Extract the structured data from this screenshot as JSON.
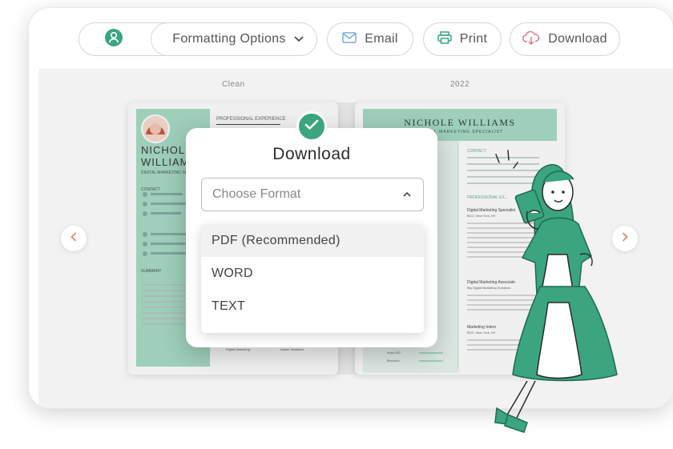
{
  "toolbar": {
    "profile_button": {
      "icon": "user-icon",
      "caret": "chevron-down-icon"
    },
    "formatting_label": "Formatting Options",
    "email_label": "Email",
    "print_label": "Print",
    "download_label": "Download"
  },
  "templates": {
    "left_label": "Clean",
    "right_label": "2022"
  },
  "resume_left": {
    "section_experience": "PROFESSIONAL EXPERIENCE",
    "name_line1": "NICHOLE",
    "name_line2": "WILLIAMS",
    "subtitle": "DIGITAL MARKETING SP",
    "contact_heading": "CONTACT",
    "summary_heading": "SUMMARY",
    "summary_text": "Digital Marketing Special... years of experience in... marketing, branding, an... strategy across multi... reinforcement industries... expanding Vicarious cent... implementing multi-pron... strategies that increase... drive brand growth.",
    "skill_a": "Digital Marketing",
    "skill_b": "Adobe Illustrator"
  },
  "resume_right": {
    "name": "NICHOLE WILLIAMS",
    "subtitle": "DIGITAL MARKETING SPECIALIST",
    "contact_heading": "CONTACT",
    "phone_label": "phone",
    "phone_value": "(123) 456-7890",
    "email_label": "email",
    "email_value": "n.williams@email.com",
    "address_label": "address",
    "address_value": "47 W 13th St, New York, NY 10011",
    "website_label": "website",
    "website_value": "n.williams.me",
    "linkedin_label": "linkedin",
    "linkedin_value": "linkedin.com/in/nwilliams",
    "experience_heading": "PROFESSIONAL EX...",
    "job1_title": "Digital Marketing Specialist",
    "job1_place": "BCG, New York, NY",
    "job2_title": "Digital Marketing Associate",
    "job2_place": "Big Digital Marketing Solutions",
    "job3_title": "Marketing Intern",
    "job3_place": "BCG, New York, NY",
    "summary_heading": "SUMMARY",
    "education_heading": "EDUCATION",
    "skills_heading": "SKILLS",
    "skill_a": "AutoCAD",
    "skill_b": "Bimvorio"
  },
  "dialog": {
    "title": "Download",
    "select_placeholder": "Choose Format",
    "options": [
      "PDF (Recommended)",
      "WORD",
      "TEXT"
    ]
  },
  "colors": {
    "accent": "#3aa57e",
    "mint": "#a8dcc6",
    "mint_light": "#cdece0",
    "stage": "#f2f2f2"
  }
}
